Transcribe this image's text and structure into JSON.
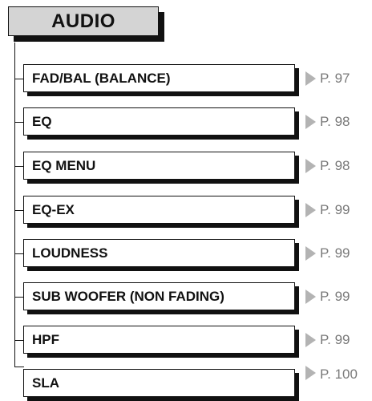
{
  "header": {
    "title": "AUDIO"
  },
  "items": [
    {
      "label": "FAD/BAL (BALANCE)",
      "page": "P. 97"
    },
    {
      "label": "EQ",
      "page": "P. 98"
    },
    {
      "label": "EQ MENU",
      "page": "P. 98"
    },
    {
      "label": "EQ-EX",
      "page": "P. 99"
    },
    {
      "label": "LOUDNESS",
      "page": "P. 99"
    },
    {
      "label": "SUB WOOFER (NON FADING)",
      "page": "P. 99"
    },
    {
      "label": "HPF",
      "page": "P. 99"
    },
    {
      "label": "SLA",
      "page": "P. 100"
    }
  ],
  "colors": {
    "header_fill": "#d4d4d4",
    "outline": "#111111",
    "arrow": "#b3b3b3",
    "page_ref_text": "#7a7a7a"
  },
  "icons": {
    "item_arrow": "right-triangle-icon"
  }
}
